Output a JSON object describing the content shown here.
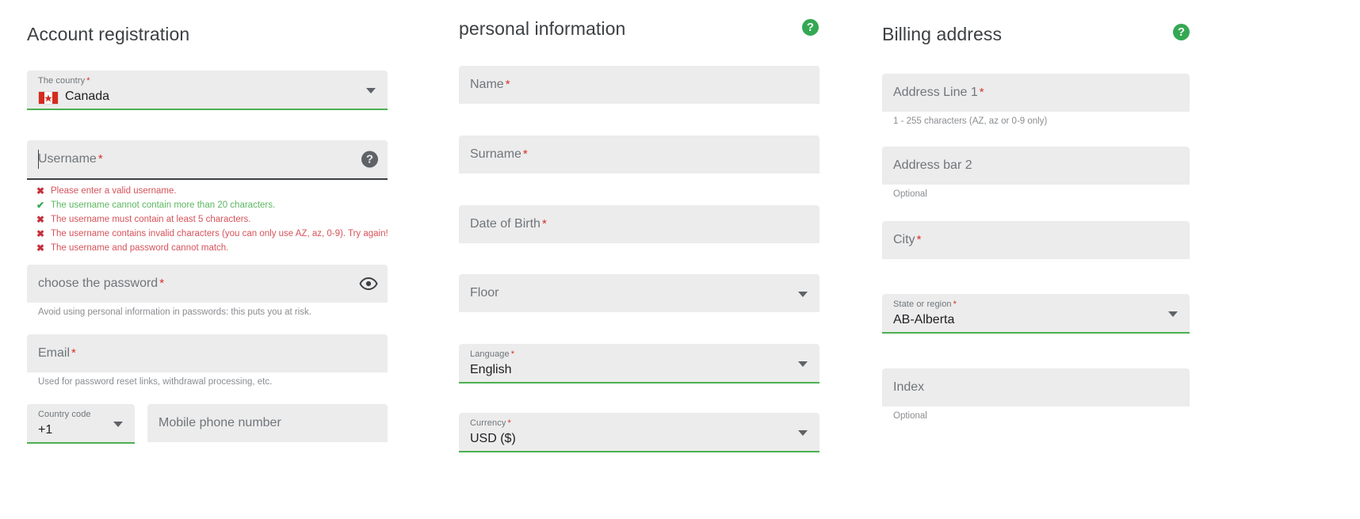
{
  "colors": {
    "accent_green": "#34a853",
    "underline_green": "#4caf50",
    "error_red": "#d6535a",
    "success_green": "#5cb661",
    "field_bg": "#ececec",
    "required_star": "#d93025"
  },
  "account": {
    "title": "Account registration",
    "country": {
      "label": "The country",
      "value": "Canada",
      "required": "*",
      "flag": "canada-flag",
      "caret": "chevron-down-icon"
    },
    "username": {
      "placeholder": "Username",
      "required": "*",
      "value": "",
      "info_icon": "?"
    },
    "validation": [
      {
        "mark": "✖",
        "state": "err",
        "text": "Please enter a valid username."
      },
      {
        "mark": "✔",
        "state": "ok",
        "text": "The username cannot contain more than 20 characters."
      },
      {
        "mark": "✖",
        "state": "err",
        "text": "The username must contain at least 5 characters."
      },
      {
        "mark": "✖",
        "state": "err",
        "text": "The username contains invalid characters (you can only use AZ, az, 0-9). Try again!"
      },
      {
        "mark": "✖",
        "state": "err",
        "text": "The username and password cannot match."
      }
    ],
    "password": {
      "placeholder": "choose the password",
      "required": "*",
      "value": "",
      "helper": "Avoid using personal information in passwords: this puts you at risk.",
      "toggle_icon": "eye-icon"
    },
    "email": {
      "placeholder": "Email",
      "required": "*",
      "value": "",
      "helper": "Used for password reset links, withdrawal processing, etc."
    },
    "country_code": {
      "label": "Country code",
      "value": "+1",
      "caret": "chevron-down-icon"
    },
    "mobile": {
      "placeholder": "Mobile phone number",
      "value": ""
    }
  },
  "personal": {
    "title": "personal information",
    "help_icon": "?",
    "name": {
      "placeholder": "Name",
      "required": "*",
      "value": ""
    },
    "surname": {
      "placeholder": "Surname",
      "required": "*",
      "value": ""
    },
    "dob": {
      "placeholder": "Date of Birth",
      "required": "*",
      "value": ""
    },
    "floor": {
      "placeholder": "Floor",
      "value": "",
      "caret": "chevron-down-icon"
    },
    "language": {
      "label": "Language",
      "required": "*",
      "value": "English",
      "caret": "chevron-down-icon"
    },
    "currency": {
      "label": "Currency",
      "required": "*",
      "value": "USD ($)",
      "caret": "chevron-down-icon"
    }
  },
  "billing": {
    "title": "Billing address",
    "help_icon": "?",
    "address1": {
      "placeholder": "Address Line 1",
      "required": "*",
      "value": "",
      "helper": "1 - 255 characters (AZ, az or 0-9 only)"
    },
    "address2": {
      "placeholder": "Address bar 2",
      "value": "",
      "helper": "Optional"
    },
    "city": {
      "placeholder": "City",
      "required": "*",
      "value": ""
    },
    "state": {
      "label": "State or region",
      "required": "*",
      "value": "AB-Alberta",
      "caret": "chevron-down-icon"
    },
    "index": {
      "placeholder": "Index",
      "value": "",
      "helper": "Optional"
    }
  }
}
